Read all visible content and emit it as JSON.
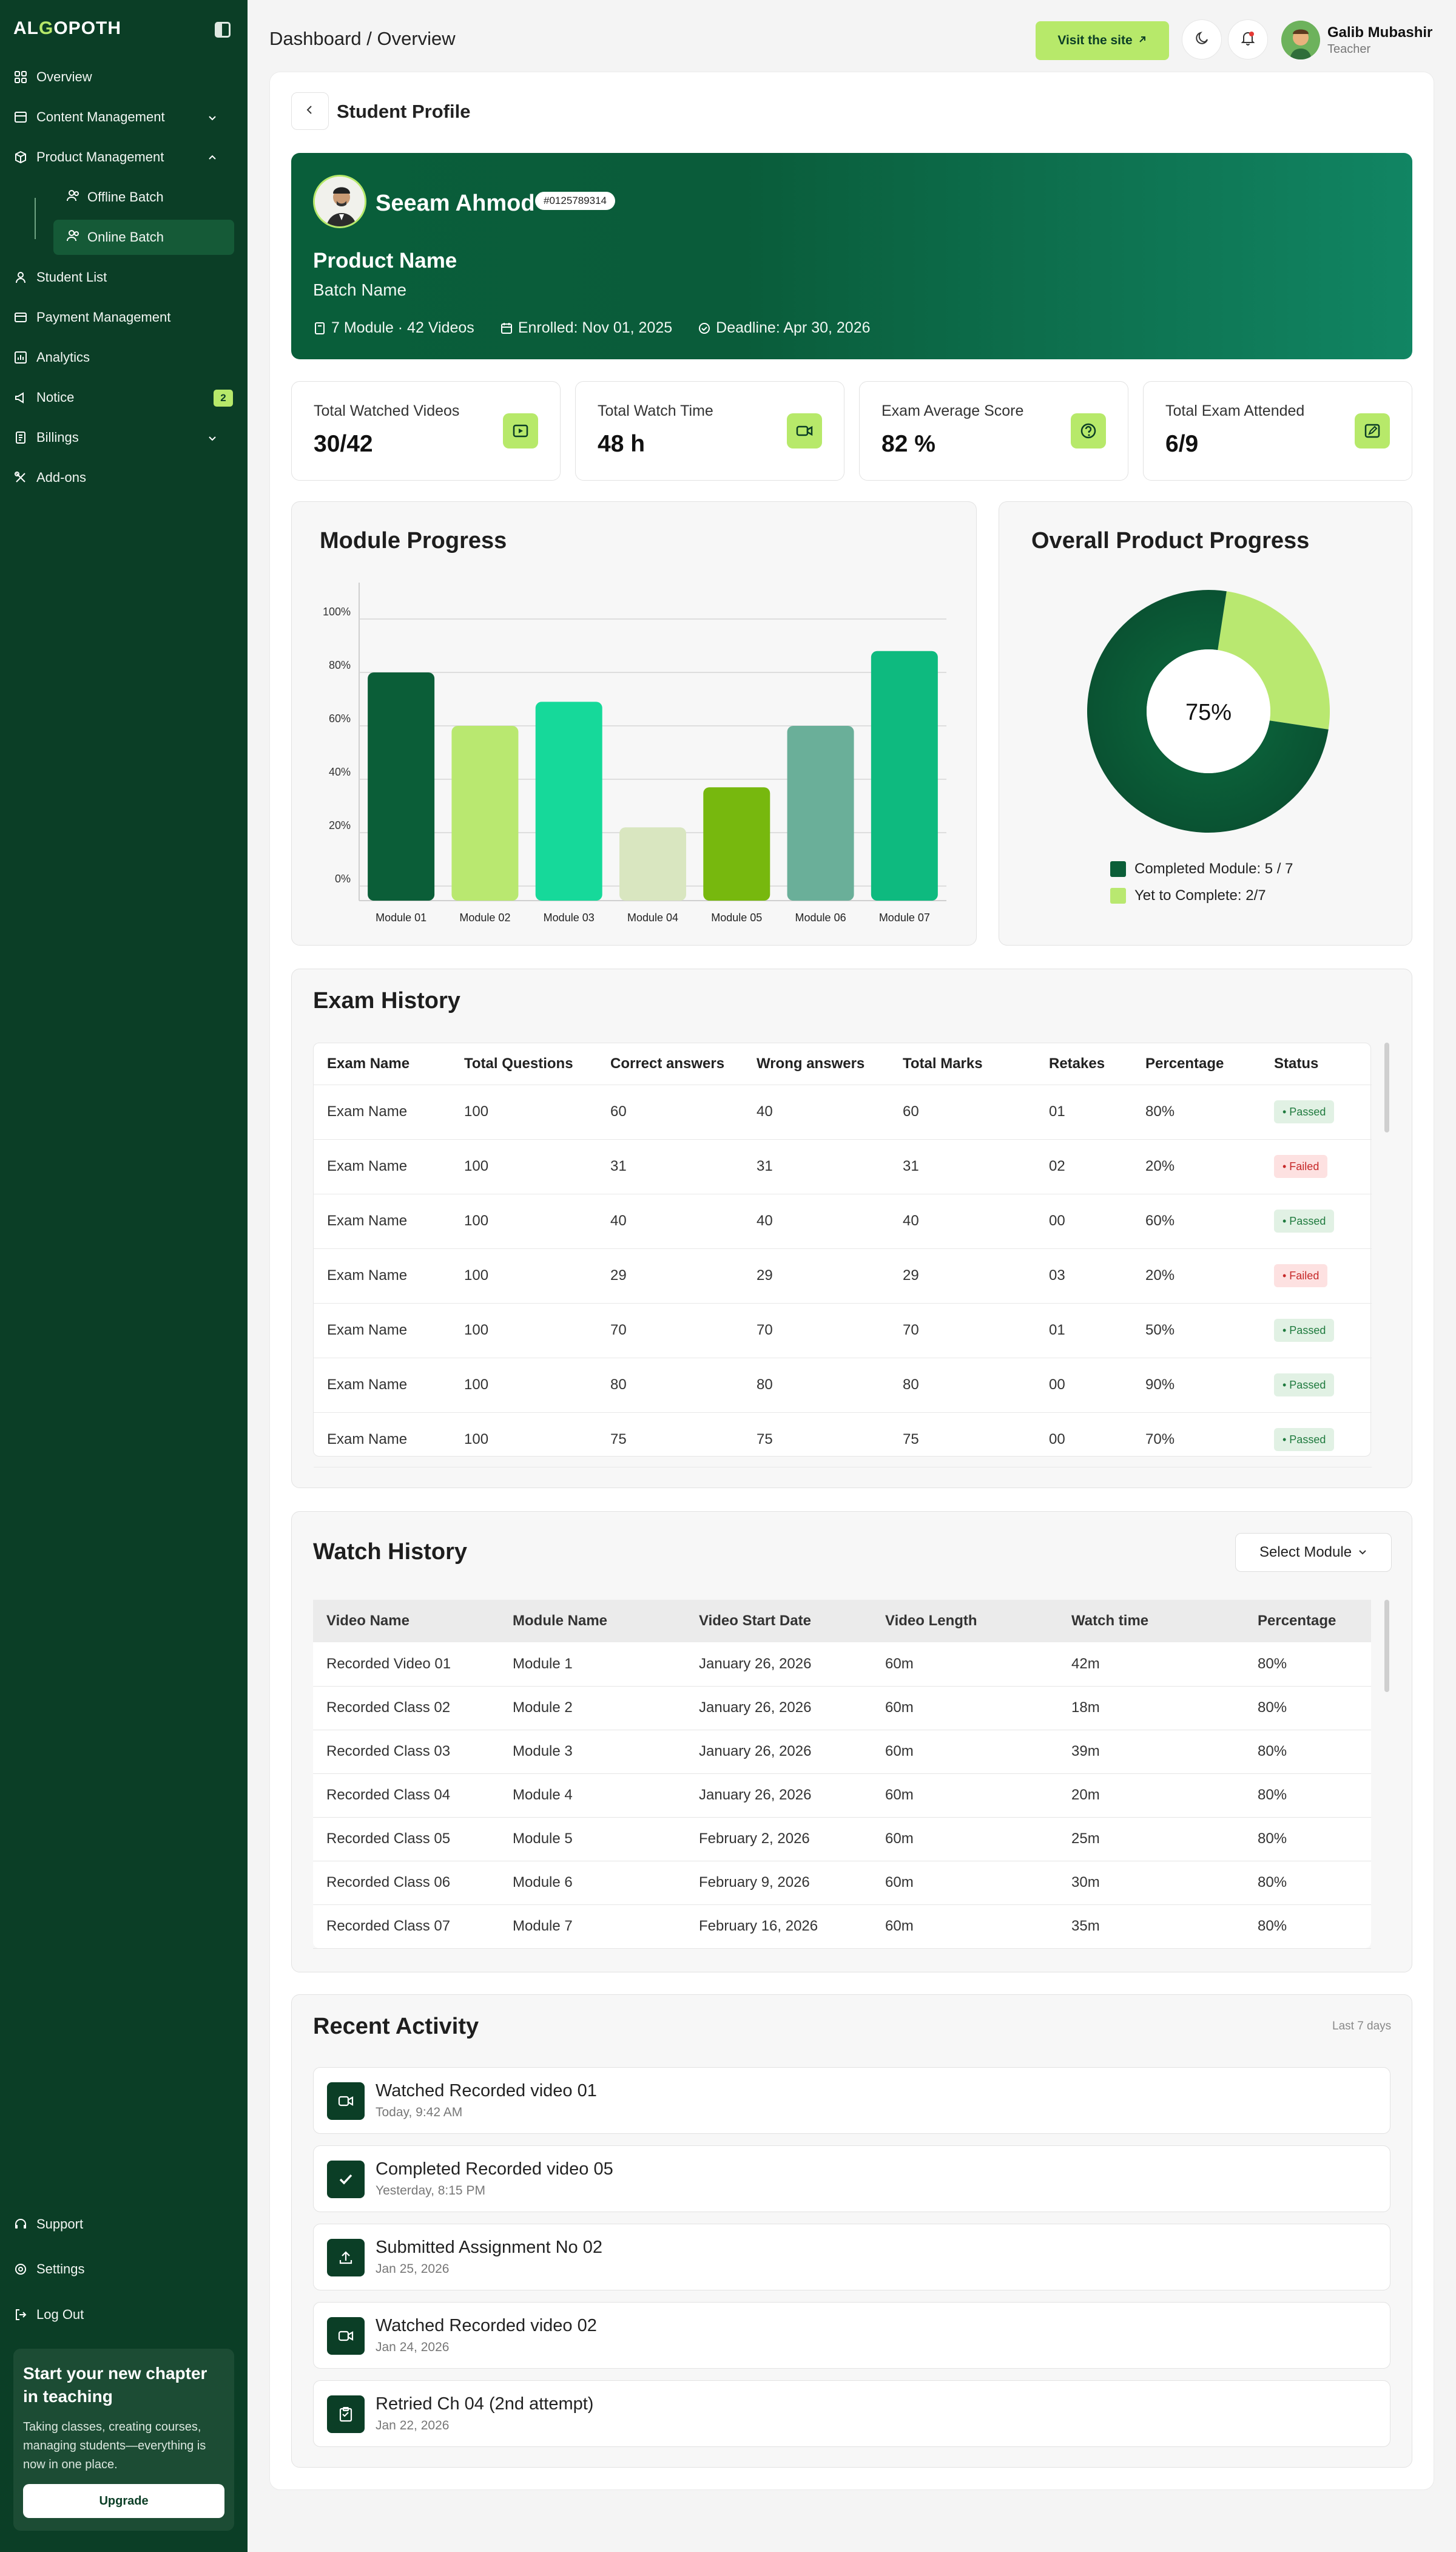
{
  "sidebar": {
    "logo": "ALGOPOTH",
    "items": [
      {
        "label": "Overview"
      },
      {
        "label": "Content Management"
      },
      {
        "label": "Product Management"
      },
      {
        "label": "Student List"
      },
      {
        "label": "Payment Management"
      },
      {
        "label": "Analytics"
      },
      {
        "label": "Notice",
        "badge": "2"
      },
      {
        "label": "Billings"
      },
      {
        "label": "Add-ons"
      }
    ],
    "sub_items": [
      {
        "label": "Offline Batch"
      },
      {
        "label": "Online Batch"
      }
    ],
    "bottom": [
      {
        "label": "Support"
      },
      {
        "label": "Settings"
      },
      {
        "label": "Log Out"
      }
    ],
    "promo": {
      "title": "Start your new chapter in teaching",
      "text": "Taking classes, creating courses, managing students—everything is now in one place.",
      "button": "Upgrade"
    }
  },
  "topbar": {
    "breadcrumb": "Dashboard / Overview",
    "visit_label": "Visit the site",
    "user_name": "Galib Mubashir",
    "user_role": "Teacher"
  },
  "page": {
    "title": "Student Profile"
  },
  "student": {
    "name": "Seeam Ahmod",
    "id": "#0125789314",
    "product": "Product Name",
    "batch": "Batch Name",
    "modules": "7 Module · 42 Videos",
    "enrolled": "Enrolled: Nov 01, 2025",
    "deadline": "Deadline: Apr 30, 2026"
  },
  "stats": [
    {
      "label": "Total Watched Videos",
      "value": "30/42",
      "icon": "video-icon"
    },
    {
      "label": "Total Watch Time",
      "value": "48 h",
      "icon": "camera-icon"
    },
    {
      "label": "Exam Average Score",
      "value": "82 %",
      "icon": "question-icon"
    },
    {
      "label": "Total Exam Attended",
      "value": "6/9",
      "icon": "edit-icon"
    }
  ],
  "module_progress": {
    "title": "Module Progress"
  },
  "overall_progress": {
    "title": "Overall Product Progress",
    "center_label": "75%",
    "legend": [
      "Completed Module: 5 / 7",
      "Yet to Complete: 2/7"
    ]
  },
  "chart_data": [
    {
      "type": "bar",
      "title": "Module Progress",
      "categories": [
        "Module 01",
        "Module 02",
        "Module 03",
        "Module 04",
        "Module 05",
        "Module 06",
        "Module 07"
      ],
      "values": [
        80,
        60,
        69,
        22,
        37,
        60,
        88
      ],
      "colors": [
        "#0b5e38",
        "#b9e870",
        "#16d99a",
        "#d9e6c0",
        "#77b80e",
        "#6aaf99",
        "#0eba7f"
      ],
      "yticks": [
        "100%",
        "80%",
        "60%",
        "40%",
        "20%",
        "0%"
      ],
      "ylim": [
        0,
        100
      ],
      "grid": true
    },
    {
      "type": "pie",
      "title": "Overall Product Progress",
      "labels": [
        "Completed Module: 5 / 7",
        "Yet to Complete: 2/7"
      ],
      "values": [
        75,
        25
      ],
      "colors": [
        "#0b5e38",
        "#b9e870"
      ],
      "center_text": "75%"
    }
  ],
  "exam_history": {
    "title": "Exam History",
    "columns": [
      "Exam Name",
      "Total Questions",
      "Correct answers",
      "Wrong answers",
      "Total Marks",
      "Retakes",
      "Percentage",
      "Status"
    ],
    "rows": [
      [
        "Exam Name",
        "100",
        "60",
        "40",
        "60",
        "01",
        "80%",
        "• Passed"
      ],
      [
        "Exam Name",
        "100",
        "31",
        "31",
        "31",
        "02",
        "20%",
        "• Failed"
      ],
      [
        "Exam Name",
        "100",
        "40",
        "40",
        "40",
        "00",
        "60%",
        "• Passed"
      ],
      [
        "Exam Name",
        "100",
        "29",
        "29",
        "29",
        "03",
        "20%",
        "• Failed"
      ],
      [
        "Exam Name",
        "100",
        "70",
        "70",
        "70",
        "01",
        "50%",
        "• Passed"
      ],
      [
        "Exam Name",
        "100",
        "80",
        "80",
        "80",
        "00",
        "90%",
        "• Passed"
      ],
      [
        "Exam Name",
        "100",
        "75",
        "75",
        "75",
        "00",
        "70%",
        "• Passed"
      ]
    ]
  },
  "watch_history": {
    "title": "Watch History",
    "select_label": "Select Module",
    "columns": [
      "Video Name",
      "Module Name",
      "Video Start Date",
      "Video Length",
      "Watch time",
      "Percentage"
    ],
    "rows": [
      [
        "Recorded Video 01",
        "Module 1",
        "January 26, 2026",
        "60m",
        "42m",
        "80%"
      ],
      [
        "Recorded Class 02",
        "Module 2",
        "January 26, 2026",
        "60m",
        "18m",
        "80%"
      ],
      [
        "Recorded Class 03",
        "Module 3",
        "January 26, 2026",
        "60m",
        "39m",
        "80%"
      ],
      [
        "Recorded Class 04",
        "Module 4",
        "January 26, 2026",
        "60m",
        "20m",
        "80%"
      ],
      [
        "Recorded Class 05",
        "Module 5",
        "February 2, 2026",
        "60m",
        "25m",
        "80%"
      ],
      [
        "Recorded Class 06",
        "Module 6",
        "February 9, 2026",
        "60m",
        "30m",
        "80%"
      ],
      [
        "Recorded Class 07",
        "Module 7",
        "February 16, 2026",
        "60m",
        "35m",
        "80%"
      ]
    ]
  },
  "recent_activity": {
    "title": "Recent Activity",
    "range": "Last 7 days",
    "items": [
      {
        "title": "Watched Recorded video 01",
        "time": "Today, 9:42 AM",
        "icon": "video-icon"
      },
      {
        "title": "Completed Recorded video 05",
        "time": "Yesterday, 8:15 PM",
        "icon": "check-icon"
      },
      {
        "title": "Submitted Assignment No 02",
        "time": "Jan 25, 2026",
        "icon": "upload-icon"
      },
      {
        "title": "Watched Recorded video 02",
        "time": "Jan 24, 2026",
        "icon": "video-icon"
      },
      {
        "title": "Retried Ch 04 (2nd attempt)",
        "time": "Jan 22, 2026",
        "icon": "clipboard-icon"
      }
    ]
  }
}
